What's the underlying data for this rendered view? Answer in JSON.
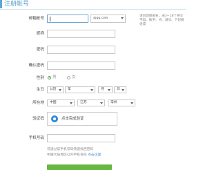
{
  "header": {
    "title": "注册帐号"
  },
  "form": {
    "email_label": "邮箱帐号",
    "email_value": "",
    "email_domain": "@qq.com",
    "hint_text": "请创建邮箱名，由3~18个英文字母、数字、点、减号、下划线组成",
    "nickname_label": "昵称",
    "password_label": "密码",
    "confirm_label": "确认密码",
    "gender_label": "性别",
    "gender_options": [
      "男",
      "女"
    ],
    "gender_selected": "男",
    "birthday_label": "生日",
    "birthday_calendar": "公历",
    "birthday_year": "年",
    "birthday_month": "月",
    "birthday_day": "日",
    "location_label": "所在地",
    "location_country": "中国",
    "location_province": "江苏",
    "location_city": "常州",
    "captcha_label": "验证码",
    "captcha_text": "点击完成验证",
    "phone_label": "手机号码",
    "phone_note": "可通过该手机号码快速找回密码",
    "phone_note2": "中国大陆地区以外手机号码",
    "phone_note2_link": "点击这里"
  },
  "colors": {
    "accent": "#5b9fcb",
    "submit": "#67b840",
    "captcha_icon": "#2e8bd8"
  }
}
